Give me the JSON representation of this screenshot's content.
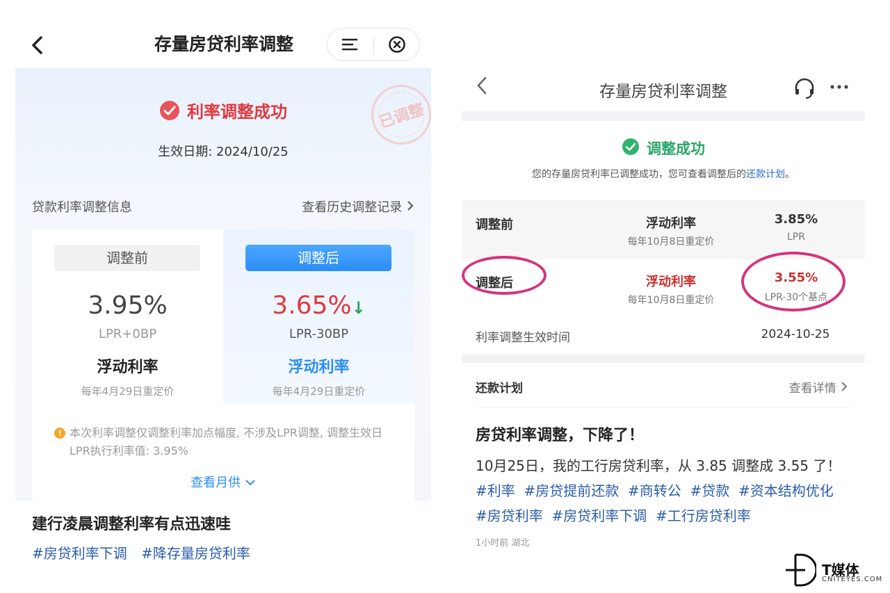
{
  "left": {
    "nav": {
      "title": "存量房贷利率调整"
    },
    "stamp": "已调整",
    "success_text": "利率调整成功",
    "effective_date": "生效日期: 2024/10/25",
    "section_title": "贷款利率调整信息",
    "history_link": "查看历史调整记录",
    "before": {
      "pill": "调整前",
      "rate": "3.95%",
      "lpr": "LPR+0BP",
      "type": "浮动利率",
      "reprice": "每年4月29日重定价"
    },
    "after": {
      "pill": "调整后",
      "rate": "3.65%",
      "down_arrow": "↓",
      "lpr": "LPR-30BP",
      "type": "浮动利率",
      "reprice": "每年4月29日重定价"
    },
    "notice": "本次利率调整仅调整利率加点幅度, 不涉及LPR调整, 调整生效日LPR执行利率值: 3.95%",
    "monthly_link": "查看月供",
    "post": {
      "title": "建行凌晨调整利率有点迅速哇",
      "tags": [
        "#房贷利率下调",
        "#降存量房贷利率"
      ]
    }
  },
  "right": {
    "nav": {
      "title": "存量房贷利率调整"
    },
    "success_text": "调整成功",
    "desc_prefix": "您的存量房贷利率已调整成功，您可查看调整后的",
    "desc_link": "还款计划",
    "desc_suffix": "。",
    "before": {
      "label": "调整前",
      "type": "浮动利率",
      "reprice": "每年10月8日重定价",
      "rate": "3.85%",
      "sub": "LPR"
    },
    "after": {
      "label": "调整后",
      "type": "浮动利率",
      "reprice": "每年10月8日重定价",
      "rate": "3.55%",
      "sub": "LPR-30个基点"
    },
    "effective_label": "利率调整生效时间",
    "effective_value": "2024-10-25",
    "plan_title": "还款计划",
    "plan_detail": "查看详情",
    "post": {
      "title": "房贷利率调整，下降了！",
      "line1": "10月25日，我的工行房贷利率，从 3.85 调整成 3.55 了！",
      "tags": [
        "#利率",
        "#房贷提前还款",
        "#商转公",
        "#贷款",
        "#资本结构优化",
        "#房贷利率",
        "#房贷利率下调",
        "#工行房贷利率"
      ],
      "meta": "1小时前 湖北"
    }
  },
  "watermark": {
    "cn": "T媒体",
    "en": "CNITEYES.COM"
  },
  "colors": {
    "success_red": "#e0383e",
    "success_green": "#2aa56a",
    "accent_blue": "#2b8ef5",
    "annotation_pink": "#d4347a"
  }
}
